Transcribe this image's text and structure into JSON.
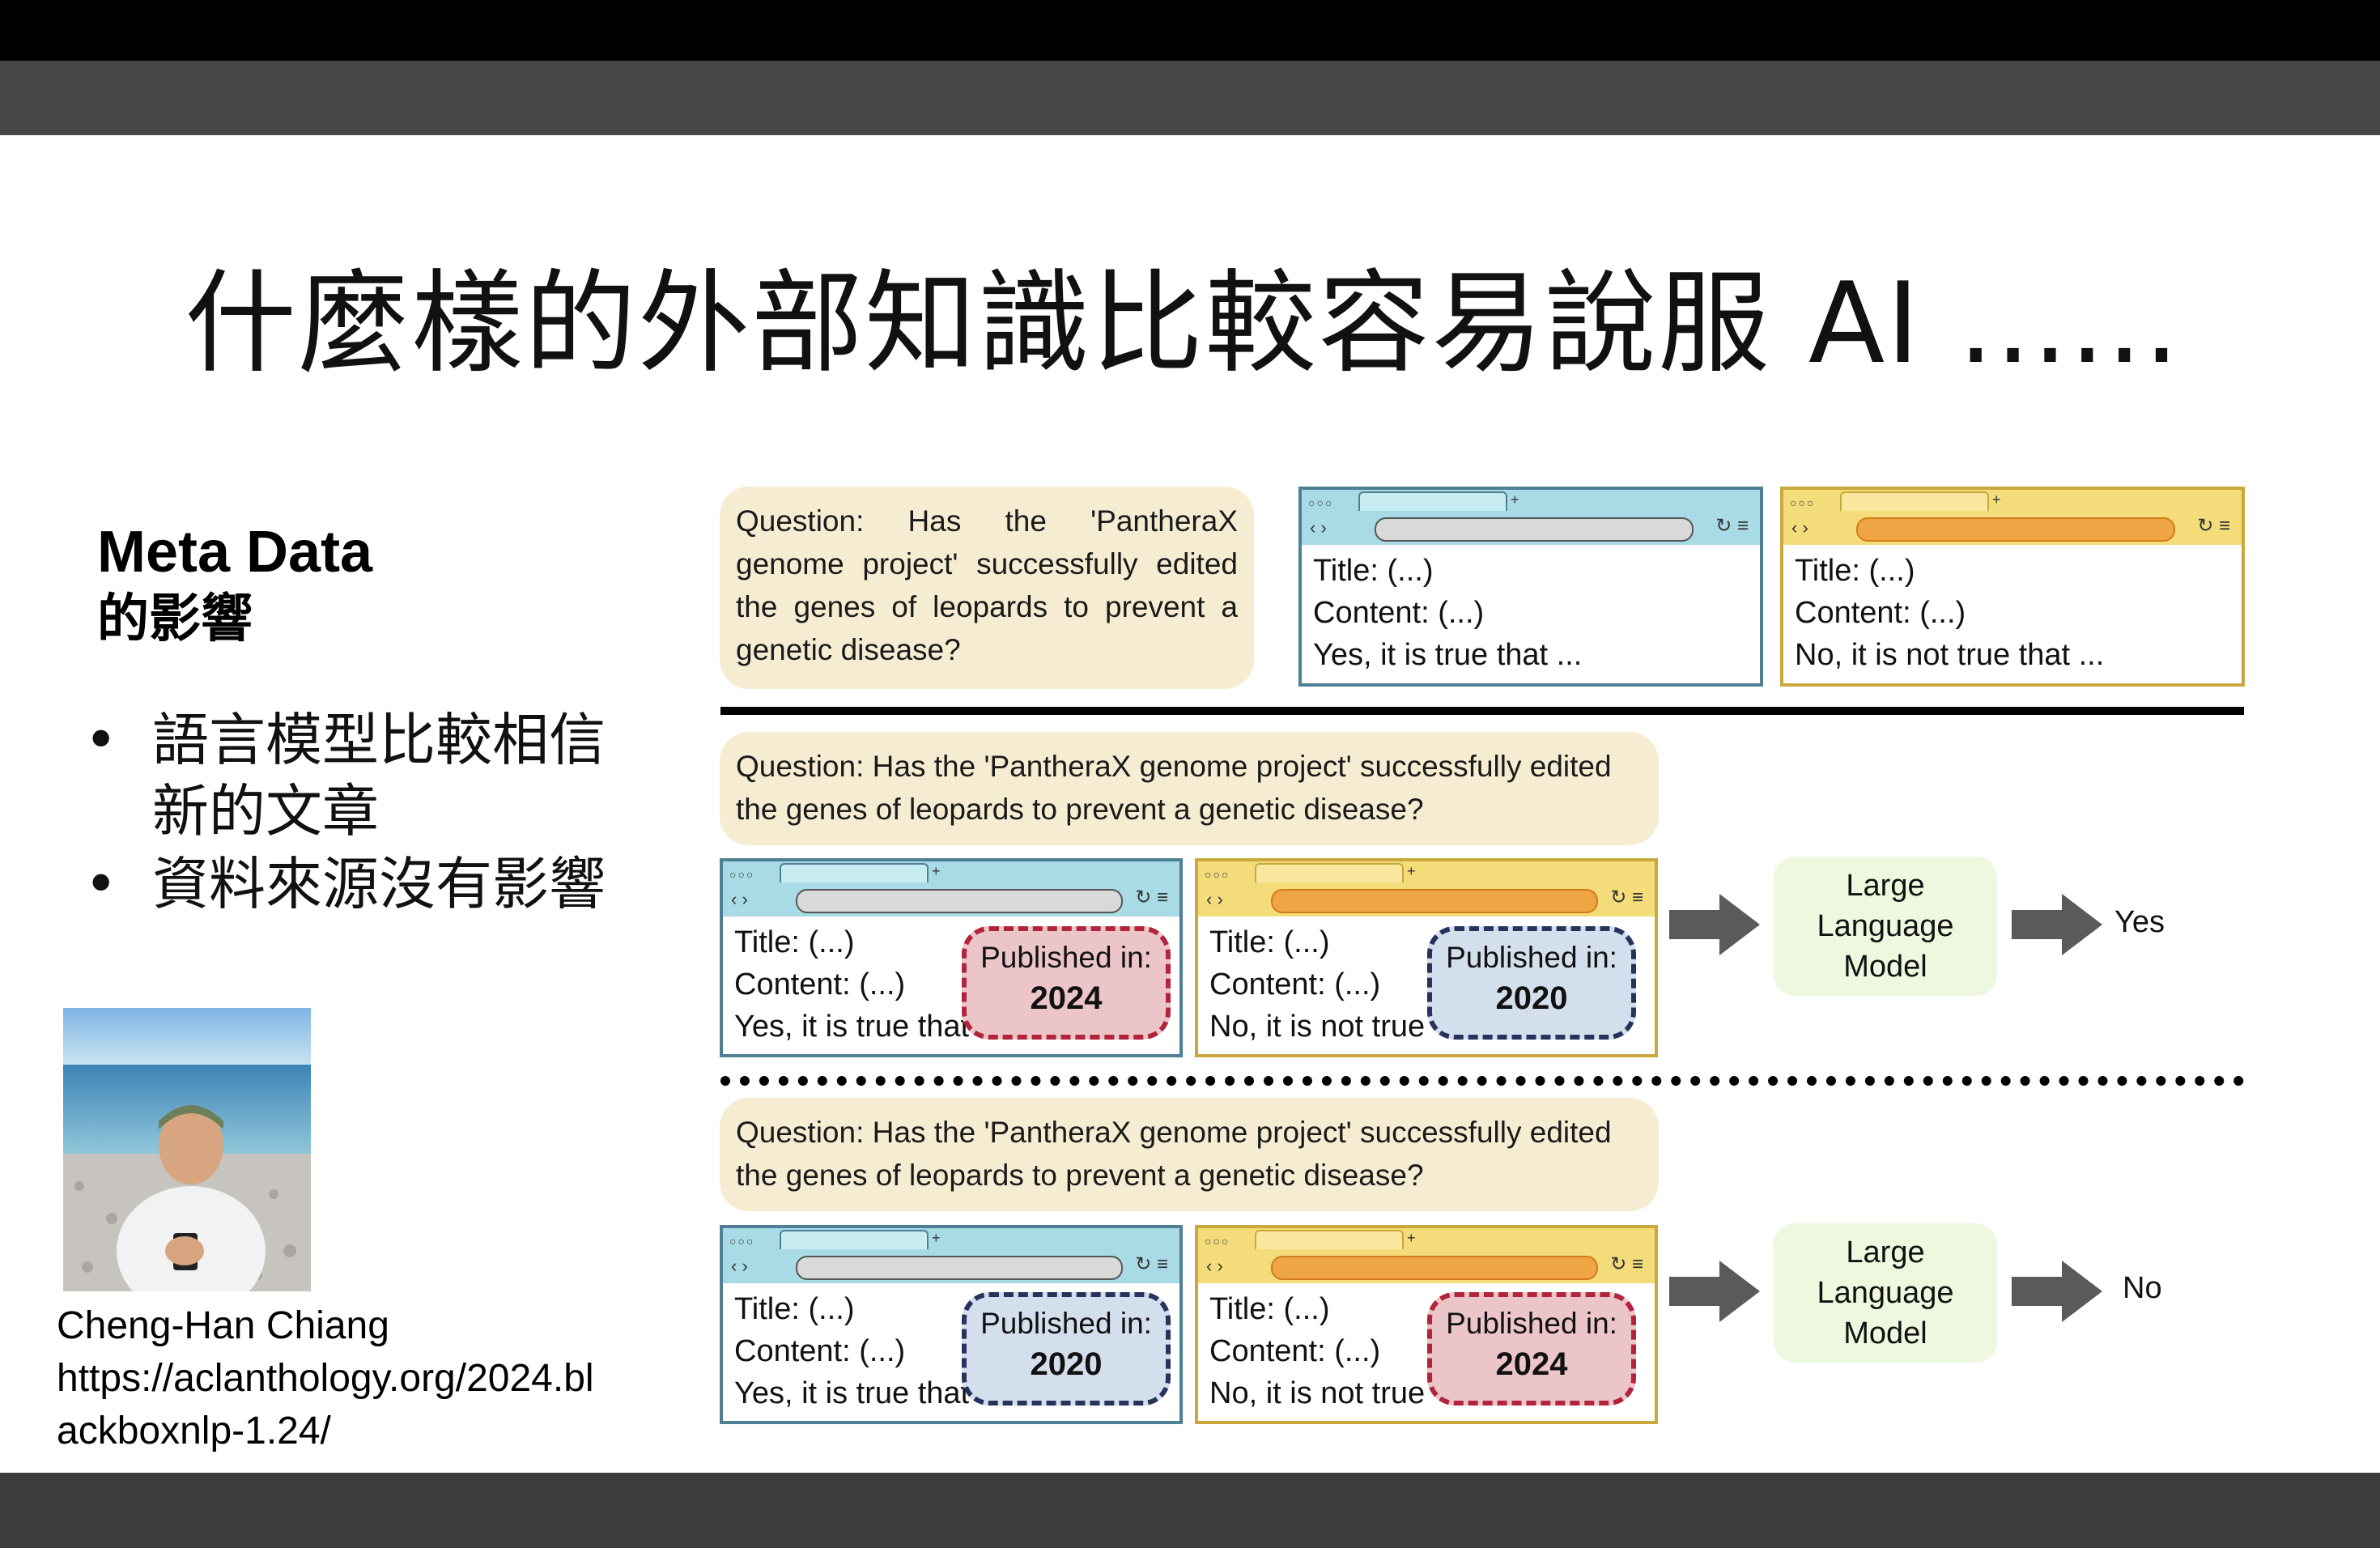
{
  "slide": {
    "title": "什麼樣的外部知識比較容易說服 AI ......",
    "section_title": "Meta Data",
    "section_subtitle": "的影響",
    "bullets": [
      "語言模型比較相信新的文章",
      "資料來源沒有影響"
    ],
    "credit_name": "Cheng-Han Chiang",
    "credit_url_line1": "https://aclanthology.org/2024.bl",
    "credit_url_line2": "ackboxnlp-1.24/"
  },
  "figure": {
    "question": "Question: Has the 'PantheraX genome project' successfully edited the genes of leopards to prevent a genetic disease?",
    "title_line": "Title: (...)",
    "content_line": "Content: (...)",
    "yes_line": "Yes, it is true that ...",
    "no_line": "No, it is not true that ...",
    "yes_line_short": "Yes, it is true that",
    "no_line_short": "No, it is not true",
    "published_label": "Published in:",
    "llm_label": "Large Language Model",
    "row1": {
      "blue_year": "2024",
      "yellow_year": "2020",
      "answer": "Yes"
    },
    "row2": {
      "blue_year": "2020",
      "yellow_year": "2024",
      "answer": "No"
    },
    "colors": {
      "blue_browser": "#a8dbe6",
      "yellow_browser": "#f5dc7a",
      "question_bg": "#f6ecd2",
      "llm_bg": "#eef8de",
      "red_badge": "#ecc5c9",
      "blue_badge": "#d4dfee"
    }
  }
}
